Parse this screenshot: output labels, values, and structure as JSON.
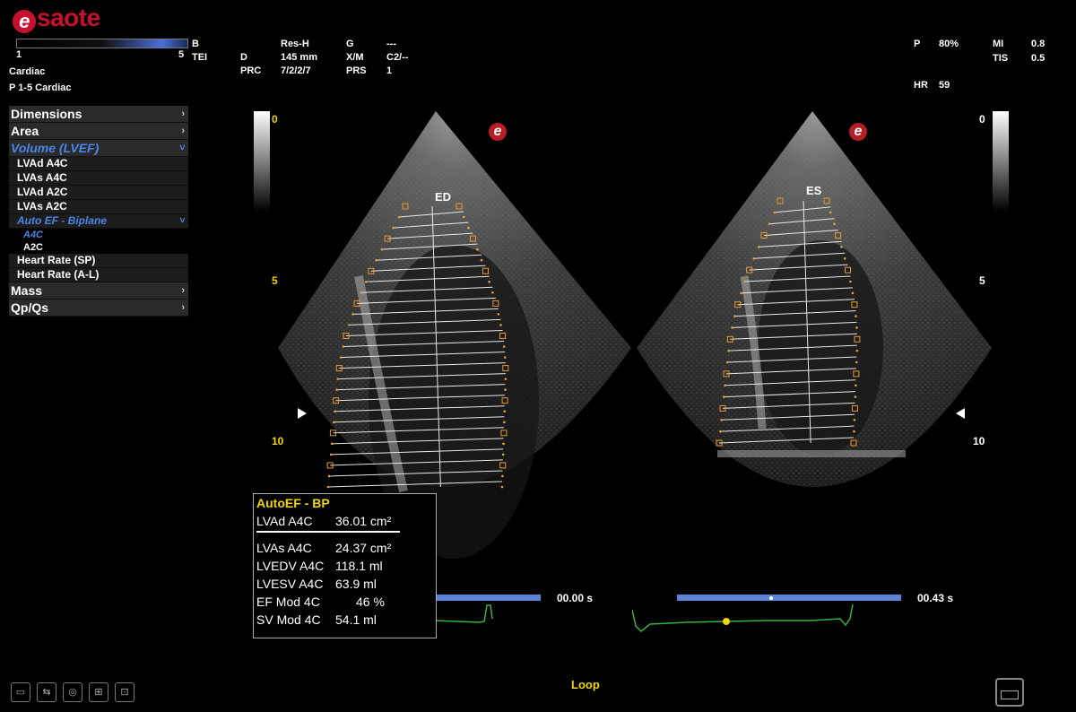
{
  "brand": {
    "logo_e": "e",
    "logo_text": "saote"
  },
  "header": {
    "gain_min": "1",
    "gain_max": "5",
    "mode": "B",
    "tei": "TEI",
    "res": "Res-H",
    "d_label": "D",
    "d_value": "145 mm",
    "prc_label": "PRC",
    "prc_value": "7/2/2/7",
    "g_label": "G",
    "g_value": "---",
    "xm_label": "X/M",
    "xm_value": "C2/--",
    "prs_label": "PRS",
    "prs_value": "1",
    "preset_line1": "Cardiac",
    "preset_line2": "P 1-5   Cardiac",
    "p_label": "P",
    "p_value": "80%",
    "mi_label": "MI",
    "mi_value": "0.8",
    "tis_label": "TIS",
    "tis_value": "0.5",
    "hr_label": "HR",
    "hr_value": "59"
  },
  "menu": {
    "dimensions": "Dimensions",
    "area": "Area",
    "volume": "Volume (LVEF)",
    "lvad_a4c": "LVAd A4C",
    "lvas_a4c": "LVAs A4C",
    "lvad_a2c": "LVAd A2C",
    "lvas_a2c": "LVAs A2C",
    "auto_ef": "Auto EF - Biplane",
    "a4c": "A4C",
    "a2c": "A2C",
    "hr_sp": "Heart Rate (SP)",
    "hr_al": "Heart Rate (A-L)",
    "mass": "Mass",
    "qpqs": "Qp/Qs",
    "chev_right": "›",
    "chev_down": "˅"
  },
  "images": {
    "left_label": "ED",
    "right_label": "ES",
    "depth_0": "0",
    "depth_5": "5",
    "depth_10": "10",
    "badge": "e"
  },
  "measurements": {
    "title": "AutoEF - BP",
    "rows_top": [
      {
        "label": "LVAd A4C",
        "value": "36.01 cm²"
      }
    ],
    "rows": [
      {
        "label": "LVAs A4C",
        "value": "24.37 cm²"
      },
      {
        "label": "LVEDV A4C",
        "value": "118.1 ml"
      },
      {
        "label": "LVESV A4C",
        "value": "63.9 ml"
      },
      {
        "label": "EF Mod 4C",
        "value": "46 %"
      },
      {
        "label": "SV Mod 4C",
        "value": "54.1 ml"
      }
    ]
  },
  "timeline": {
    "left_time": "00.00 s",
    "right_time": "00.43 s",
    "loop": "Loop"
  },
  "status_icons": [
    "battery-icon",
    "usb-icon",
    "disc-icon",
    "network-icon",
    "dicom-icon"
  ],
  "colors": {
    "accent_blue": "#4a86e8",
    "highlight_yellow": "#f2d600",
    "ecg_green": "#3cb043",
    "brand_red": "#c8102e"
  }
}
